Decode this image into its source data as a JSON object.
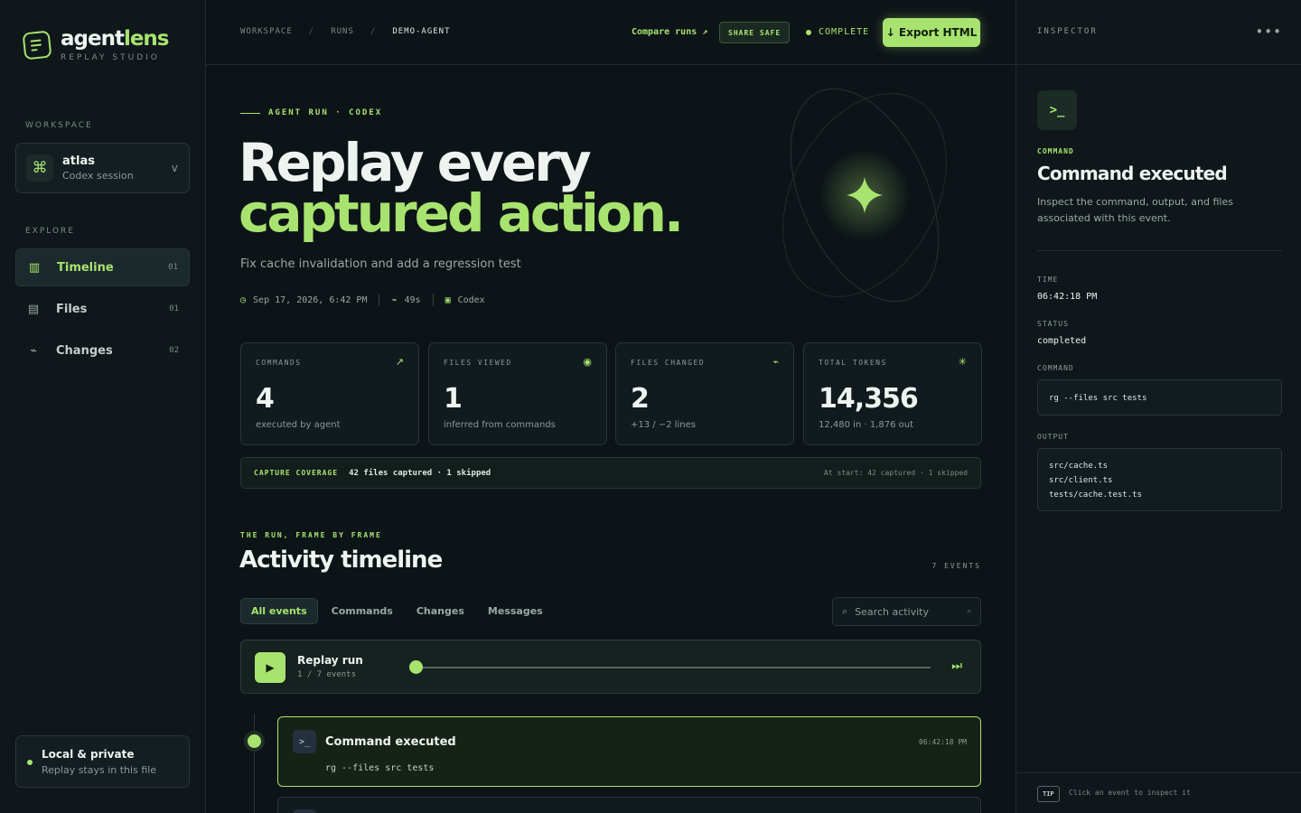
{
  "brand": {
    "name_part1": "agent",
    "name_part2": "lens",
    "subtitle": "REPLAY STUDIO",
    "accent_color": "#a8e36f"
  },
  "sidebar": {
    "workspace_label": "WORKSPACE",
    "workspace": {
      "name": "atlas",
      "subtitle": "Codex session",
      "chevron": "v"
    },
    "explore_label": "EXPLORE",
    "items": [
      {
        "label": "Timeline",
        "count": "01",
        "icon": "columns-icon",
        "active": true
      },
      {
        "label": "Files",
        "count": "01",
        "icon": "file-list-icon",
        "active": false
      },
      {
        "label": "Changes",
        "count": "02",
        "icon": "diff-icon",
        "active": false
      }
    ],
    "local": {
      "title": "Local & private",
      "subtitle": "Replay stays in this file"
    }
  },
  "topbar": {
    "breadcrumb": [
      "WORKSPACE",
      "RUNS",
      "DEMO-AGENT"
    ],
    "breadcrumb_sep": "/",
    "compare_label": "Compare runs ↗",
    "share_label": "SHARE SAFE",
    "status_label": "COMPLETE",
    "export_label": "↓ Export HTML"
  },
  "hero": {
    "eyebrow": "AGENT RUN · CODEX",
    "title_line1": "Replay every",
    "title_line2": "captured action.",
    "subtitle": "Fix cache invalidation and add a regression test",
    "meta": {
      "date": "Sep 17, 2026, 6:42 PM",
      "duration": "49s",
      "agent": "Codex"
    }
  },
  "stats": [
    {
      "label": "COMMANDS",
      "value": "4",
      "sub": "executed by agent",
      "icon": "↗"
    },
    {
      "label": "FILES VIEWED",
      "value": "1",
      "sub": "inferred from commands",
      "icon": "◉"
    },
    {
      "label": "FILES CHANGED",
      "value": "2",
      "sub": "+13 / −2 lines",
      "icon": "⌁"
    },
    {
      "label": "TOTAL TOKENS",
      "value": "14,356",
      "sub": "12,480 in · 1,876 out",
      "icon": "✳"
    }
  ],
  "coverage": {
    "label": "CAPTURE COVERAGE",
    "value": "42 files captured · 1 skipped",
    "right": "At start: 42 captured · 1 skipped"
  },
  "timeline": {
    "eyebrow": "THE RUN, FRAME BY FRAME",
    "title": "Activity timeline",
    "count": "7 EVENTS",
    "filters": [
      "All events",
      "Commands",
      "Changes",
      "Messages"
    ],
    "search_placeholder": "Search activity",
    "search_hint": "⌕"
  },
  "replay": {
    "title": "Replay run",
    "progress_text": "1 / 7 events",
    "position": 0.0
  },
  "events": [
    {
      "title": "Command executed",
      "time": "06:42:18 PM",
      "command": "rg --files src tests",
      "icon": ">_"
    }
  ],
  "inspector": {
    "label": "INSPECTOR",
    "more": "•••",
    "icon": ">_",
    "kicker": "COMMAND",
    "title": "Command executed",
    "description": "Inspect the command, output, and files associated with this event.",
    "time_label": "TIME",
    "time": "06:42:18 PM",
    "status_label": "STATUS",
    "status": "completed",
    "command_label": "COMMAND",
    "command": "rg --files src tests",
    "output_label": "OUTPUT",
    "output": [
      "src/cache.ts",
      "src/client.ts",
      "tests/cache.test.ts"
    ],
    "tip_badge": "TIP",
    "tip": "Click an event to inspect it"
  }
}
